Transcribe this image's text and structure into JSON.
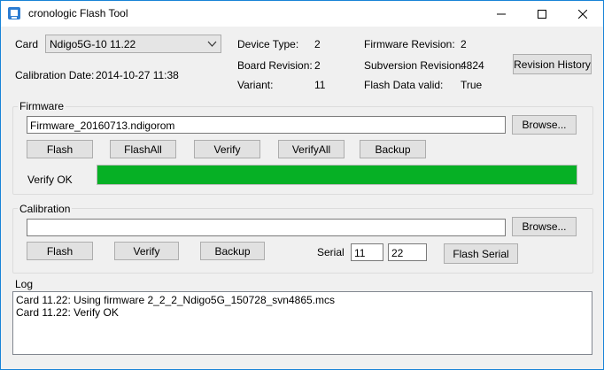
{
  "window": {
    "title": "cronologic Flash Tool",
    "accent": "#1883d7"
  },
  "card": {
    "label": "Card",
    "selected": "Ndigo5G-10 11.22"
  },
  "calibration_date": {
    "label": "Calibration Date:",
    "value": "2014-10-27 11:38"
  },
  "device_info": {
    "device_type_label": "Device Type:",
    "device_type": "2",
    "board_revision_label": "Board Revision:",
    "board_revision": "2",
    "variant_label": "Variant:",
    "variant": "11",
    "firmware_revision_label": "Firmware Revision:",
    "firmware_revision": "2",
    "subversion_revision_label": "Subversion Revision:",
    "subversion_revision": "4824",
    "flash_data_valid_label": "Flash Data valid:",
    "flash_data_valid": "True"
  },
  "revision_history_button": "Revision History",
  "firmware": {
    "group_label": "Firmware",
    "file": "Firmware_20160713.ndigorom",
    "browse": "Browse...",
    "flash": "Flash",
    "flash_all": "FlashAll",
    "verify": "Verify",
    "verify_all": "VerifyAll",
    "backup": "Backup",
    "status": "Verify OK",
    "progress_fraction": 1.0,
    "progress_color": "#06b025"
  },
  "calibration": {
    "group_label": "Calibration",
    "file": "",
    "browse": "Browse...",
    "flash": "Flash",
    "verify": "Verify",
    "backup": "Backup",
    "serial_label": "Serial",
    "serial_part1": "11",
    "serial_part2": "22",
    "flash_serial": "Flash Serial"
  },
  "log": {
    "label": "Log",
    "lines": [
      "Card 11.22: Using firmware 2_2_2_Ndigo5G_150728_svn4865.mcs",
      "Card 11.22: Verify OK"
    ]
  }
}
